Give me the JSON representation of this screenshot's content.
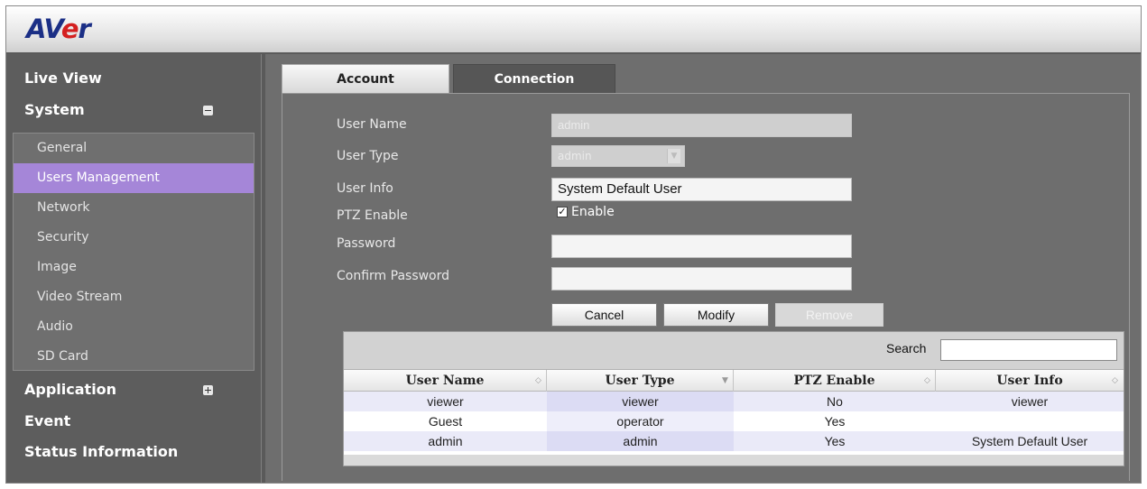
{
  "header": {
    "logo_prefix": "AV",
    "logo_e": "e",
    "logo_suffix": "r"
  },
  "sidebar": {
    "live_view": "Live View",
    "system": "System",
    "sub_items": [
      "General",
      "Users Management",
      "Network",
      "Security",
      "Image",
      "Video Stream",
      "Audio",
      "SD Card"
    ],
    "active_sub_item": "Users Management",
    "application": "Application",
    "event": "Event",
    "status_information": "Status Information"
  },
  "tabs": {
    "account": "Account",
    "connection": "Connection",
    "active": "Account"
  },
  "form": {
    "user_name_label": "User Name",
    "user_name_value": "admin",
    "user_type_label": "User Type",
    "user_type_value": "admin",
    "user_info_label": "User Info",
    "user_info_value": "System Default User",
    "ptz_label": "PTZ Enable",
    "ptz_checked": true,
    "ptz_check_text": "Enable",
    "password_label": "Password",
    "password_value": "",
    "confirm_label": "Confirm Password",
    "confirm_value": ""
  },
  "buttons": {
    "cancel": "Cancel",
    "modify": "Modify",
    "remove": "Remove"
  },
  "table": {
    "search_label": "Search",
    "search_value": "",
    "columns": [
      "User Name",
      "User Type",
      "PTZ Enable",
      "User Info"
    ],
    "rows": [
      [
        "viewer",
        "viewer",
        "No",
        "viewer"
      ],
      [
        "Guest",
        "operator",
        "Yes",
        ""
      ],
      [
        "admin",
        "admin",
        "Yes",
        "System Default User"
      ]
    ]
  },
  "icons": {
    "collapse": "minus-icon",
    "expand": "plus-icon",
    "checkbox": "check-icon",
    "dropdown": "chevron-down-icon"
  },
  "colors": {
    "active_item": "#a586d8",
    "logo_blue": "#1b2f86",
    "logo_red": "#d42020"
  }
}
